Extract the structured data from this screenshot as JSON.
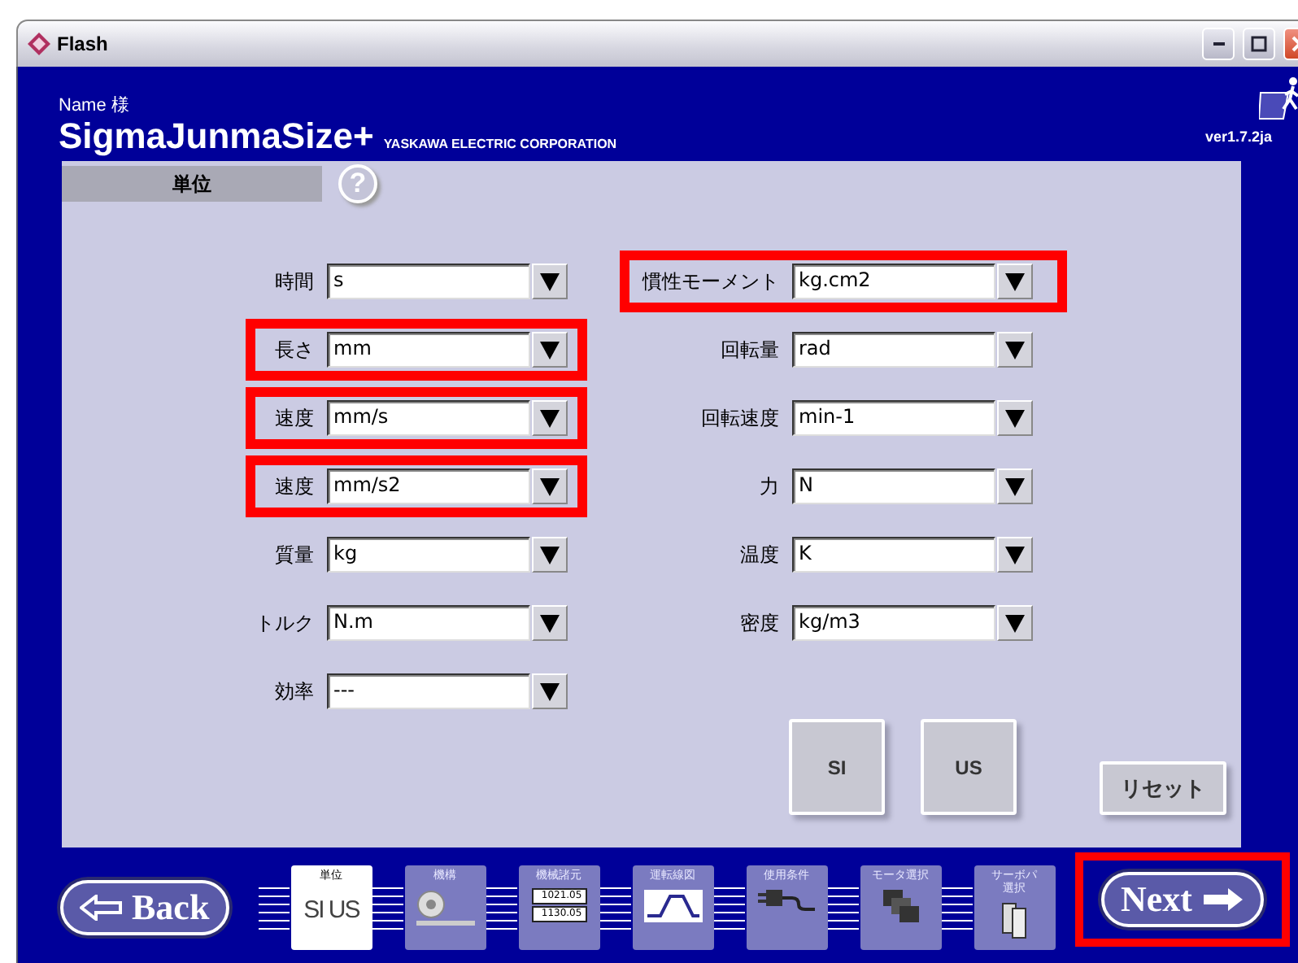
{
  "window": {
    "title": "Flash"
  },
  "header": {
    "user": "Name 様",
    "app_name": "SigmaJunmaSize+",
    "company": "YASKAWA ELECTRIC CORPORATION",
    "version": "ver1.7.2ja"
  },
  "section": {
    "title": "単位",
    "help": "?"
  },
  "units_left": [
    {
      "label": "時間",
      "value": "s",
      "highlighted": false
    },
    {
      "label": "長さ",
      "value": "mm",
      "highlighted": true
    },
    {
      "label": "速度",
      "value": "mm/s",
      "highlighted": true
    },
    {
      "label": "速度",
      "value": "mm/s2",
      "highlighted": true
    },
    {
      "label": "質量",
      "value": "kg",
      "highlighted": false
    },
    {
      "label": "トルク",
      "value": "N.m",
      "highlighted": false
    },
    {
      "label": "効率",
      "value": "---",
      "highlighted": false
    }
  ],
  "units_right": [
    {
      "label": "慣性モーメント",
      "value": "kg.cm2",
      "highlighted": true
    },
    {
      "label": "回転量",
      "value": "rad",
      "highlighted": false
    },
    {
      "label": "回転速度",
      "value": "min-1",
      "highlighted": false
    },
    {
      "label": "力",
      "value": "N",
      "highlighted": false
    },
    {
      "label": "温度",
      "value": "K",
      "highlighted": false
    },
    {
      "label": "密度",
      "value": "kg/m3",
      "highlighted": false
    }
  ],
  "system_buttons": [
    "SI",
    "US"
  ],
  "reset_button": "リセット",
  "nav": {
    "back": "Back",
    "next": "Next",
    "next_highlighted": true
  },
  "steps": [
    {
      "label": [
        "単位"
      ],
      "kind": "units",
      "caption": "SI US",
      "selected": true
    },
    {
      "label": [
        "機構"
      ],
      "kind": "gear",
      "selected": false
    },
    {
      "label": [
        "機械諸元"
      ],
      "kind": "numbers",
      "values": [
        "1021.05",
        "1130.05"
      ],
      "selected": false
    },
    {
      "label": [
        "運転線図"
      ],
      "kind": "graph",
      "selected": false
    },
    {
      "label": [
        "使用条件"
      ],
      "kind": "plug",
      "selected": false
    },
    {
      "label": [
        "モータ選択"
      ],
      "kind": "motors",
      "selected": false
    },
    {
      "label": [
        "サーボパ",
        "選択"
      ],
      "kind": "servo",
      "selected": false
    }
  ]
}
